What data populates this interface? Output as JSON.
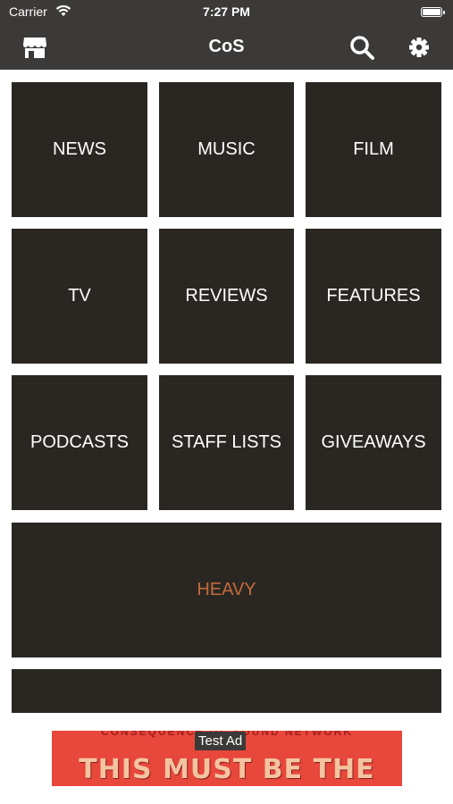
{
  "status_bar": {
    "carrier": "Carrier",
    "time": "7:27 PM"
  },
  "nav": {
    "title": "CoS",
    "left_icon": "store-icon",
    "right_icons": [
      "search-icon",
      "gear-icon"
    ]
  },
  "tiles": [
    {
      "label": "NEWS"
    },
    {
      "label": "MUSIC"
    },
    {
      "label": "FILM"
    },
    {
      "label": "TV"
    },
    {
      "label": "REVIEWS"
    },
    {
      "label": "FEATURES"
    },
    {
      "label": "PODCASTS"
    },
    {
      "label": "STAFF LISTS"
    },
    {
      "label": "GIVEAWAYS"
    },
    {
      "label": "HEAVY"
    },
    {
      "label": ""
    }
  ],
  "ad": {
    "badge": "Test Ad",
    "top_text": "CONSEQUENCE OF SOUND NETWORK",
    "main_text": "THIS MUST BE THE GIG"
  },
  "colors": {
    "bar": "#3b3a38",
    "tile": "#2a2723",
    "heavy": "#c46a3b"
  }
}
